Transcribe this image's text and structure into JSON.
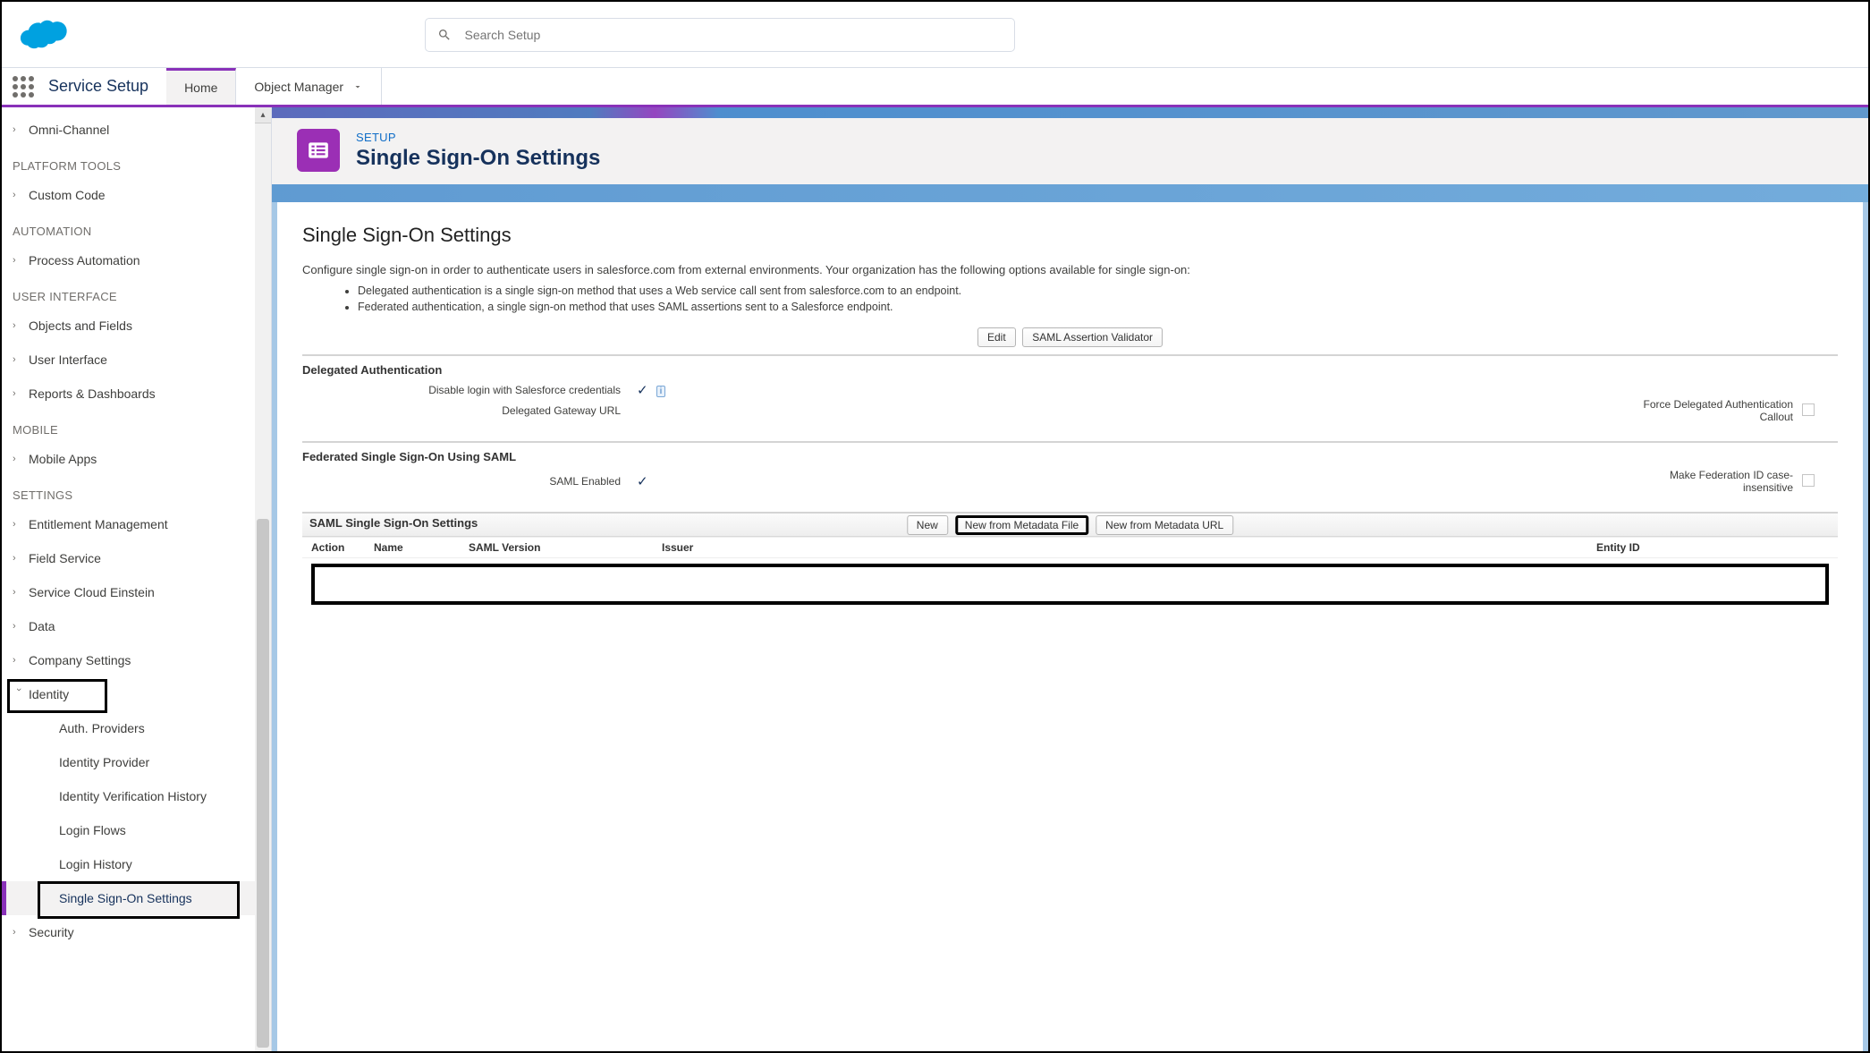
{
  "search": {
    "placeholder": "Search Setup"
  },
  "nav": {
    "appName": "Service Setup",
    "tabs": [
      {
        "label": "Home",
        "active": true
      },
      {
        "label": "Object Manager",
        "active": false,
        "hasMenu": true
      }
    ]
  },
  "sidebar": {
    "items": [
      {
        "type": "item",
        "label": "Omni-Channel"
      },
      {
        "type": "section",
        "label": "PLATFORM TOOLS"
      },
      {
        "type": "item",
        "label": "Custom Code"
      },
      {
        "type": "section",
        "label": "AUTOMATION"
      },
      {
        "type": "item",
        "label": "Process Automation"
      },
      {
        "type": "section",
        "label": "USER INTERFACE"
      },
      {
        "type": "item",
        "label": "Objects and Fields"
      },
      {
        "type": "item",
        "label": "User Interface"
      },
      {
        "type": "item",
        "label": "Reports & Dashboards"
      },
      {
        "type": "section",
        "label": "MOBILE"
      },
      {
        "type": "item",
        "label": "Mobile Apps"
      },
      {
        "type": "section",
        "label": "SETTINGS"
      },
      {
        "type": "item",
        "label": "Entitlement Management"
      },
      {
        "type": "item",
        "label": "Field Service"
      },
      {
        "type": "item",
        "label": "Service Cloud Einstein"
      },
      {
        "type": "item",
        "label": "Data"
      },
      {
        "type": "item",
        "label": "Company Settings"
      },
      {
        "type": "item",
        "label": "Identity",
        "expanded": true,
        "highlighted": true
      },
      {
        "type": "child",
        "label": "Auth. Providers"
      },
      {
        "type": "child",
        "label": "Identity Provider"
      },
      {
        "type": "child",
        "label": "Identity Verification History"
      },
      {
        "type": "child",
        "label": "Login Flows"
      },
      {
        "type": "child",
        "label": "Login History"
      },
      {
        "type": "child",
        "label": "Single Sign-On Settings",
        "active": true,
        "highlighted": true
      },
      {
        "type": "item",
        "label": "Security"
      }
    ]
  },
  "header": {
    "breadcrumb": "SETUP",
    "title": "Single Sign-On Settings"
  },
  "page": {
    "heading": "Single Sign-On Settings",
    "intro": "Configure single sign-on in order to authenticate users in salesforce.com from external environments. Your organization has the following options available for single sign-on:",
    "bullets": [
      "Delegated authentication is a single sign-on method that uses a Web service call sent from salesforce.com to an endpoint.",
      "Federated authentication, a single sign-on method that uses SAML assertions sent to a Salesforce endpoint."
    ],
    "buttons": {
      "edit": "Edit",
      "validator": "SAML Assertion Validator"
    },
    "delegated": {
      "title": "Delegated Authentication",
      "disableLabel": "Disable login with Salesforce credentials",
      "disableChecked": "✓",
      "gatewayLabel": "Delegated Gateway URL",
      "forceLabel": "Force Delegated Authentication Callout"
    },
    "federated": {
      "title": "Federated Single Sign-On Using SAML",
      "enabledLabel": "SAML Enabled",
      "enabledChecked": "✓",
      "caseLabel": "Make Federation ID case-insensitive"
    },
    "samlTable": {
      "title": "SAML Single Sign-On Settings",
      "buttons": {
        "new": "New",
        "newFile": "New from Metadata File",
        "newUrl": "New from Metadata URL"
      },
      "columns": {
        "action": "Action",
        "name": "Name",
        "version": "SAML Version",
        "issuer": "Issuer",
        "entity": "Entity ID"
      }
    }
  }
}
